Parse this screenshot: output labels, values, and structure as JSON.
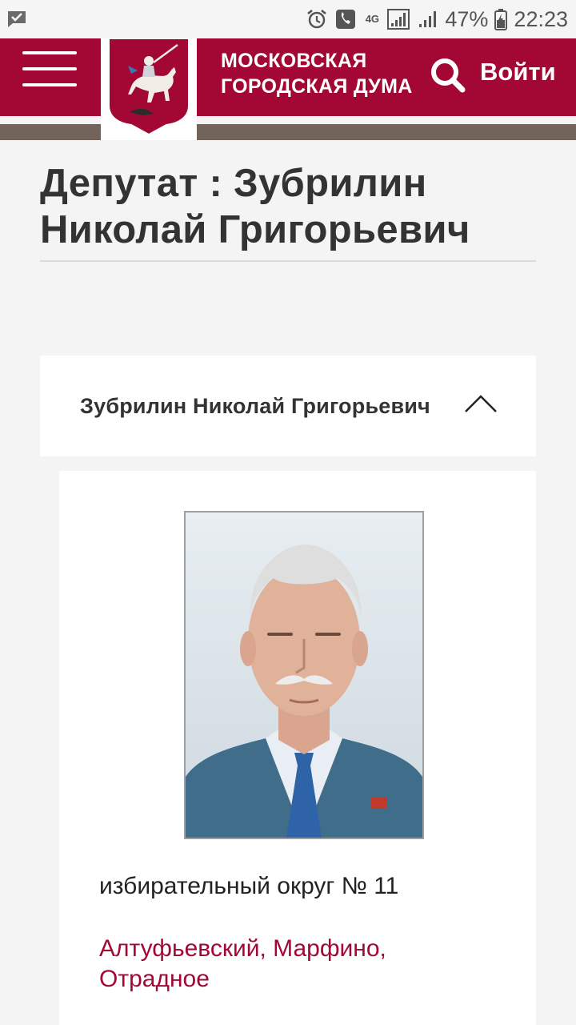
{
  "status_bar": {
    "battery_percent": "47%",
    "time": "22:23",
    "network": "4G",
    "icons": [
      "notification-check-icon",
      "alarm-icon",
      "call-icon",
      "4g-icon",
      "signal-icon",
      "signal-icon",
      "battery-icon"
    ]
  },
  "header": {
    "org_name_line1": "МОСКОВСКАЯ",
    "org_name_line2": "ГОРОДСКАЯ ДУМА",
    "login_label": "Войти",
    "colors": {
      "brand": "#a20833",
      "band": "#72645b"
    }
  },
  "page": {
    "title_line1": "Депутат : Зубрилин",
    "title_line2": "Николай Григорьевич"
  },
  "deputy": {
    "accordion_title": "Зубрилин Николай Григорьевич",
    "district": "избирательный округ № 11",
    "areas_line1": "Алтуфьевский, Марфино,",
    "areas_line2": "Отрадное"
  }
}
